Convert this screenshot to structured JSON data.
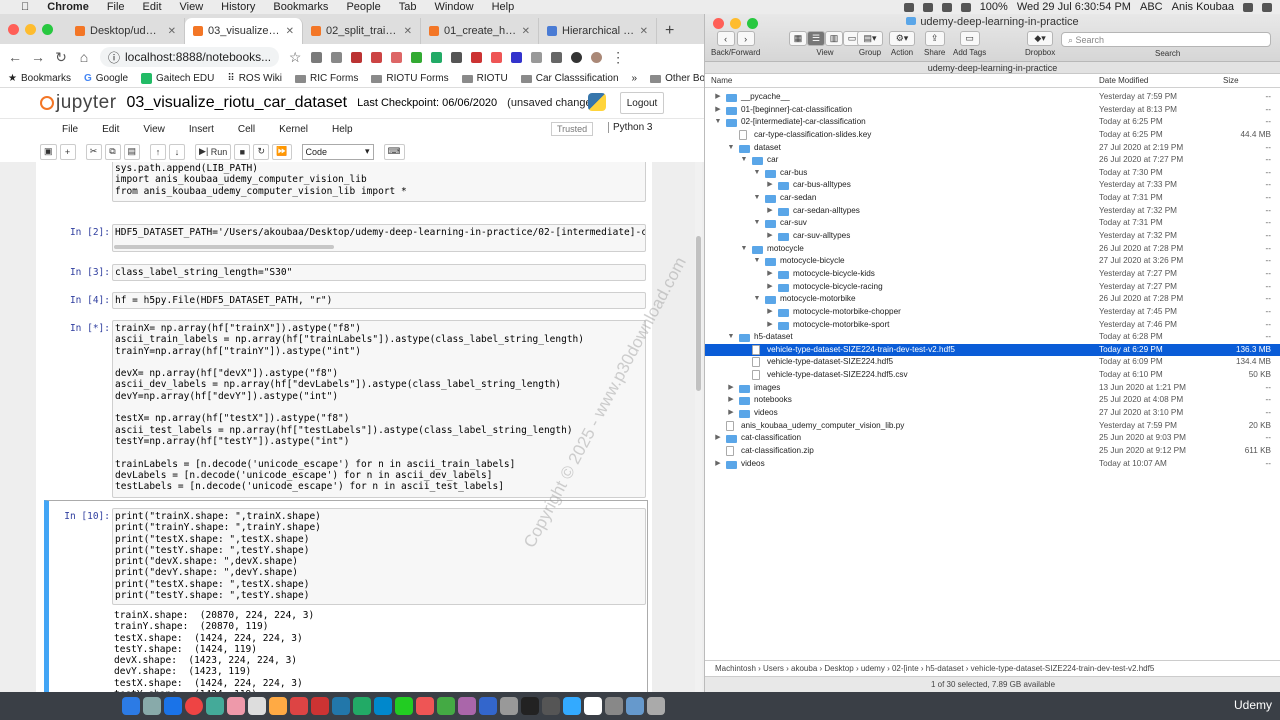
{
  "menubar": {
    "apple": "",
    "items": [
      "Chrome",
      "File",
      "Edit",
      "View",
      "History",
      "Bookmarks",
      "People",
      "Tab",
      "Window",
      "Help"
    ],
    "battery": "100%",
    "datetime": "Wed 29 Jul  6:30:54 PM",
    "input_source": "ABC",
    "user": "Anis Koubaa"
  },
  "chrome": {
    "tabs": [
      {
        "label": "Desktop/udemy-de"
      },
      {
        "label": "03_visualize_riotu_c"
      },
      {
        "label": "02_split_train_dev_t"
      },
      {
        "label": "01_create_h5_datas"
      },
      {
        "label": "Hierarchical Data Fo"
      }
    ],
    "url": "localhost:8888/notebooks...",
    "bookmarks": [
      "Bookmarks",
      "Google",
      "Gaitech EDU",
      "ROS Wiki",
      "RIC Forms",
      "RIOTU Forms",
      "RIOTU",
      "Car Classsification"
    ],
    "other_bookmarks": "Other Bookmarks"
  },
  "jupyter": {
    "logo": "jupyter",
    "notebook": "03_visualize_riotu_car_dataset",
    "checkpoint": "Last Checkpoint: 06/06/2020",
    "unsaved": "(unsaved changes)",
    "logout": "Logout",
    "menu": [
      "File",
      "Edit",
      "View",
      "Insert",
      "Cell",
      "Kernel",
      "Help"
    ],
    "trusted": "Trusted",
    "kernel": "Python 3",
    "run": "Run",
    "celltype": "Code",
    "cells": [
      {
        "prompt": "",
        "code": "sys.path.append(LIB_PATH)\nimport anis_koubaa_udemy_computer_vision_lib\nfrom anis_koubaa_udemy_computer_vision_lib import *"
      },
      {
        "prompt": "In [2]:",
        "code": "HDF5_DATASET_PATH='/Users/akoubaa/Desktop/udemy-deep-learning-in-practice/02-[intermediate]-car"
      },
      {
        "prompt": "In [3]:",
        "code": "class_label_string_length=\"S30\""
      },
      {
        "prompt": "In [4]:",
        "code": "hf = h5py.File(HDF5_DATASET_PATH, \"r\")"
      },
      {
        "prompt": "In [*]:",
        "code": "trainX= np.array(hf[\"trainX\"]).astype(\"f8\")\nascii_train_labels = np.array(hf[\"trainLabels\"]).astype(class_label_string_length)\ntrainY=np.array(hf[\"trainY\"]).astype(\"int\")\n\ndevX= np.array(hf[\"devX\"]).astype(\"f8\")\nascii_dev_labels = np.array(hf[\"devLabels\"]).astype(class_label_string_length)\ndevY=np.array(hf[\"devY\"]).astype(\"int\")\n\ntestX= np.array(hf[\"testX\"]).astype(\"f8\")\nascii_test_labels = np.array(hf[\"testLabels\"]).astype(class_label_string_length)\ntestY=np.array(hf[\"testY\"]).astype(\"int\")\n\ntrainLabels = [n.decode('unicode_escape') for n in ascii_train_labels]\ndevLabels = [n.decode('unicode_escape') for n in ascii_dev_labels]\ntestLabels = [n.decode('unicode_escape') for n in ascii_test_labels]"
      },
      {
        "prompt": "In [10]:",
        "code": "print(\"trainX.shape: \",trainX.shape)\nprint(\"trainY.shape: \",trainY.shape)\nprint(\"testX.shape: \",testX.shape)\nprint(\"testY.shape: \",testY.shape)\nprint(\"devX.shape: \",devX.shape)\nprint(\"devY.shape: \",devY.shape)\nprint(\"testX.shape: \",testX.shape)\nprint(\"testY.shape: \",testY.shape)"
      }
    ],
    "output": "trainX.shape:  (20870, 224, 224, 3)\ntrainY.shape:  (20870, 119)\ntestX.shape:  (1424, 224, 224, 3)\ntestY.shape:  (1424, 119)\ndevX.shape:  (1423, 224, 224, 3)\ndevY.shape:  (1423, 119)\ntestX.shape:  (1424, 224, 224, 3)\ntestY.shape:  (1424, 119)",
    "watermark": "Copyright © 2025 - www.p30download.com"
  },
  "finder": {
    "title": "udemy-deep-learning-in-practice",
    "toolbar": [
      "Back/Forward",
      "View",
      "Group",
      "Action",
      "Share",
      "Add Tags",
      "Dropbox",
      "Search"
    ],
    "search_placeholder": "Search",
    "path_title": "udemy-deep-learning-in-practice",
    "columns": {
      "name": "Name",
      "date": "Date Modified",
      "size": "Size"
    },
    "rows": [
      {
        "lvl": 0,
        "kind": "folder",
        "open": false,
        "name": "__pycache__",
        "date": "Yesterday at 7:59 PM",
        "size": "--"
      },
      {
        "lvl": 0,
        "kind": "folder",
        "open": false,
        "name": "01-[beginner]-cat-classification",
        "date": "Yesterday at 8:13 PM",
        "size": "--"
      },
      {
        "lvl": 0,
        "kind": "folder",
        "open": true,
        "name": "02-[intermediate]-car-classification",
        "date": "Today at 6:25 PM",
        "size": "--"
      },
      {
        "lvl": 1,
        "kind": "file",
        "name": "car-type-classification-slides.key",
        "date": "Today at 6:25 PM",
        "size": "44.4 MB"
      },
      {
        "lvl": 1,
        "kind": "folder",
        "open": true,
        "name": "dataset",
        "date": "27 Jul 2020 at 2:19 PM",
        "size": "--"
      },
      {
        "lvl": 2,
        "kind": "folder",
        "open": true,
        "name": "car",
        "date": "26 Jul 2020 at 7:27 PM",
        "size": "--"
      },
      {
        "lvl": 3,
        "kind": "folder",
        "open": true,
        "name": "car-bus",
        "date": "Today at 7:30 PM",
        "size": "--"
      },
      {
        "lvl": 4,
        "kind": "folder",
        "open": false,
        "name": "car-bus-alltypes",
        "date": "Yesterday at 7:33 PM",
        "size": "--"
      },
      {
        "lvl": 3,
        "kind": "folder",
        "open": true,
        "name": "car-sedan",
        "date": "Today at 7:31 PM",
        "size": "--"
      },
      {
        "lvl": 4,
        "kind": "folder",
        "open": false,
        "name": "car-sedan-alltypes",
        "date": "Yesterday at 7:32 PM",
        "size": "--"
      },
      {
        "lvl": 3,
        "kind": "folder",
        "open": true,
        "name": "car-suv",
        "date": "Today at 7:31 PM",
        "size": "--"
      },
      {
        "lvl": 4,
        "kind": "folder",
        "open": false,
        "name": "car-suv-alltypes",
        "date": "Yesterday at 7:32 PM",
        "size": "--"
      },
      {
        "lvl": 2,
        "kind": "folder",
        "open": true,
        "name": "motocycle",
        "date": "26 Jul 2020 at 7:28 PM",
        "size": "--"
      },
      {
        "lvl": 3,
        "kind": "folder",
        "open": true,
        "name": "motocycle-bicycle",
        "date": "27 Jul 2020 at 3:26 PM",
        "size": "--"
      },
      {
        "lvl": 4,
        "kind": "folder",
        "open": false,
        "name": "motocycle-bicycle-kids",
        "date": "Yesterday at 7:27 PM",
        "size": "--"
      },
      {
        "lvl": 4,
        "kind": "folder",
        "open": false,
        "name": "motocycle-bicycle-racing",
        "date": "Yesterday at 7:27 PM",
        "size": "--"
      },
      {
        "lvl": 3,
        "kind": "folder",
        "open": true,
        "name": "motocycle-motorbike",
        "date": "26 Jul 2020 at 7:28 PM",
        "size": "--"
      },
      {
        "lvl": 4,
        "kind": "folder",
        "open": false,
        "name": "motocycle-motorbike-chopper",
        "date": "Yesterday at 7:45 PM",
        "size": "--"
      },
      {
        "lvl": 4,
        "kind": "folder",
        "open": false,
        "name": "motocycle-motorbike-sport",
        "date": "Yesterday at 7:46 PM",
        "size": "--"
      },
      {
        "lvl": 1,
        "kind": "folder",
        "open": true,
        "name": "h5-dataset",
        "date": "Today at 6:28 PM",
        "size": "--"
      },
      {
        "lvl": 2,
        "kind": "file",
        "name": "vehicle-type-dataset-SIZE224-train-dev-test-v2.hdf5",
        "date": "Today at 6:29 PM",
        "size": "136.3 MB",
        "selected": true
      },
      {
        "lvl": 2,
        "kind": "file",
        "name": "vehicle-type-dataset-SIZE224.hdf5",
        "date": "Today at 6:09 PM",
        "size": "134.4 MB"
      },
      {
        "lvl": 2,
        "kind": "file",
        "name": "vehicle-type-dataset-SIZE224.hdf5.csv",
        "date": "Today at 6:10 PM",
        "size": "50 KB"
      },
      {
        "lvl": 1,
        "kind": "folder",
        "open": false,
        "name": "images",
        "date": "13 Jun 2020 at 1:21 PM",
        "size": "--"
      },
      {
        "lvl": 1,
        "kind": "folder",
        "open": false,
        "name": "notebooks",
        "date": "25 Jul 2020 at 4:08 PM",
        "size": "--"
      },
      {
        "lvl": 1,
        "kind": "folder",
        "open": false,
        "name": "videos",
        "date": "27 Jul 2020 at 3:10 PM",
        "size": "--"
      },
      {
        "lvl": 0,
        "kind": "file",
        "name": "anis_koubaa_udemy_computer_vision_lib.py",
        "date": "Yesterday at 7:59 PM",
        "size": "20 KB"
      },
      {
        "lvl": 0,
        "kind": "folder",
        "open": false,
        "name": "cat-classification",
        "date": "25 Jun 2020 at 9:03 PM",
        "size": "--"
      },
      {
        "lvl": 0,
        "kind": "file",
        "name": "cat-classification.zip",
        "date": "25 Jun 2020 at 9:12 PM",
        "size": "611 KB"
      },
      {
        "lvl": 0,
        "kind": "folder",
        "open": false,
        "name": "videos",
        "date": "Today at 10:07 AM",
        "size": "--"
      }
    ],
    "pathbar": "Machintosh  ›  Users  ›  akouba  ›  Desktop  ›  udemy  ›  02-[inte  ›  h5-dataset  ›  vehicle-type-dataset-SIZE224-train-dev-test-v2.hdf5",
    "status": "1 of 30 selected, 7.89 GB available"
  },
  "dock": {
    "label": "Udemy"
  }
}
